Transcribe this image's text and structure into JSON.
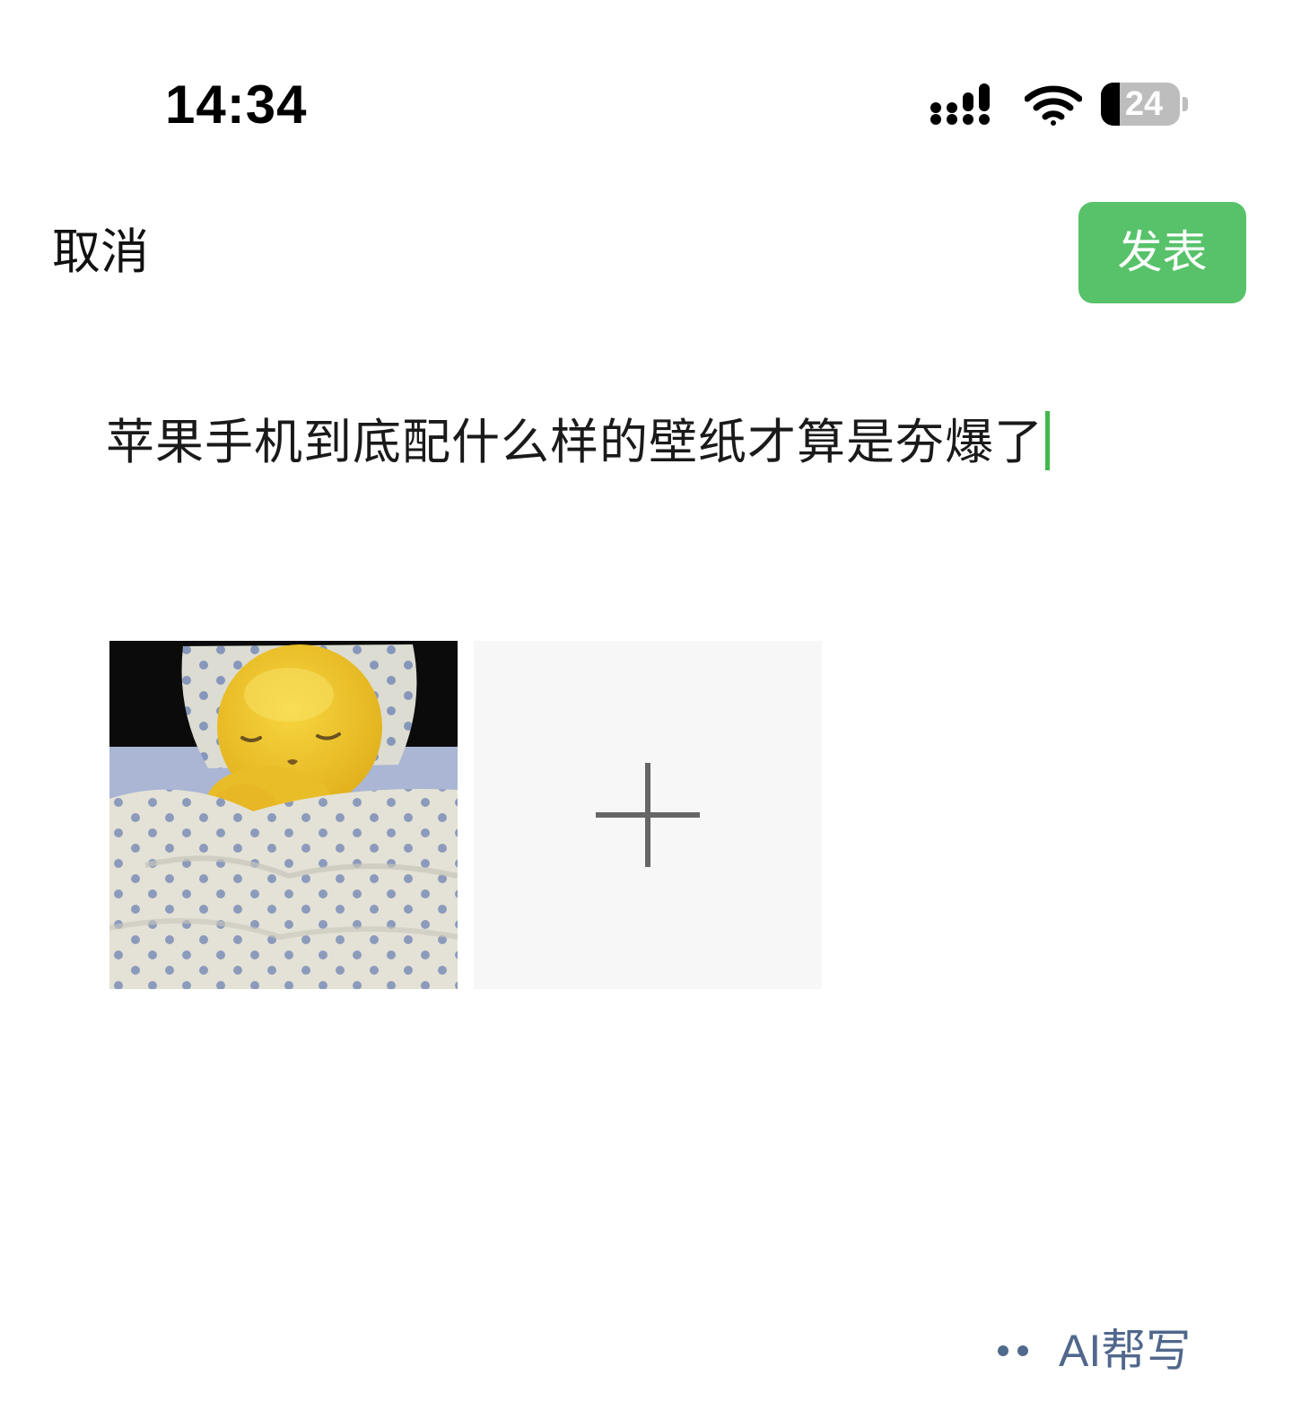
{
  "status_bar": {
    "time": "14:34",
    "battery_percent": "24",
    "battery_level": 0.24,
    "icons": [
      "signal-icon",
      "wifi-icon",
      "battery-icon"
    ]
  },
  "nav": {
    "cancel_label": "取消",
    "publish_label": "发表",
    "publish_color": "#57c26a"
  },
  "post": {
    "text": "苹果手机到底配什么样的壁纸才算是夯爆了",
    "caret_color": "#41b84b"
  },
  "images": {
    "thumbnail_alt": "sleeping yellow character in bed",
    "add_icon": "plus-icon"
  },
  "ai_help": {
    "label": "AI帮写",
    "color": "#51678c"
  }
}
